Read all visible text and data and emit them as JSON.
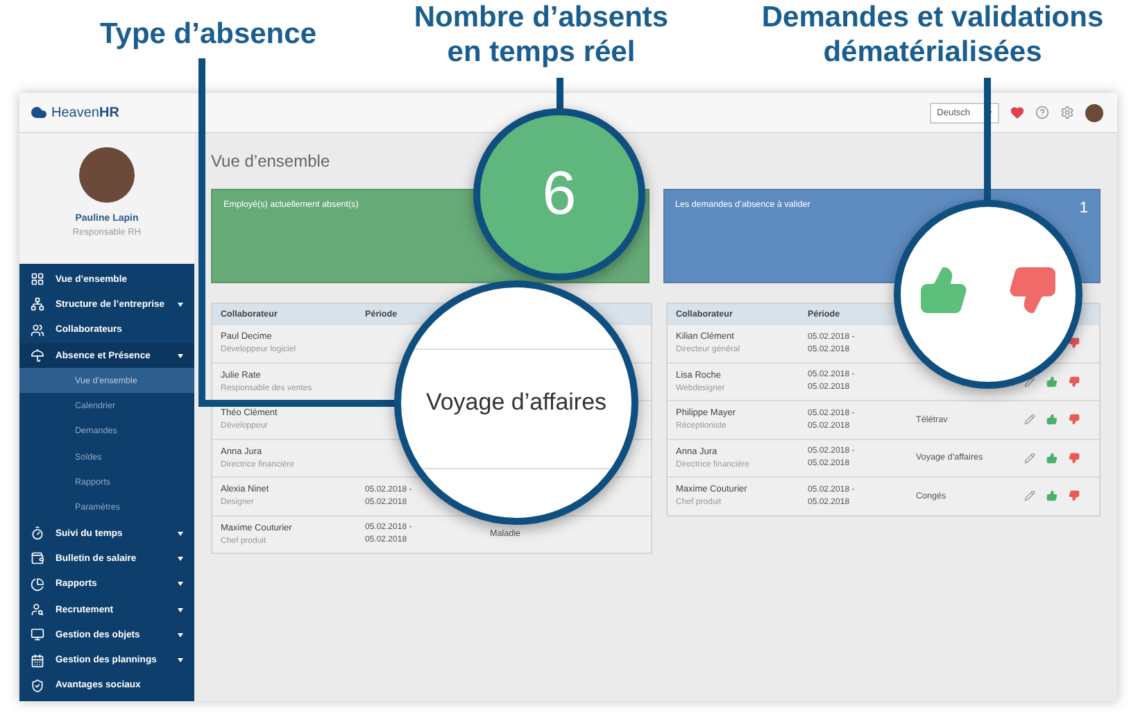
{
  "callouts": [
    {
      "lines": [
        "Type d’absence"
      ]
    },
    {
      "lines": [
        "Nombre d’absents",
        "en temps réel"
      ]
    },
    {
      "lines": [
        "Demandes et validations",
        "dématérialisées"
      ]
    }
  ],
  "magnifiers": {
    "absent_count": "6",
    "absence_type": "Voyage d’affaires"
  },
  "topbar": {
    "logo": "Heaven**HR**",
    "language": "Deutsch"
  },
  "profile": {
    "name": "Pauline Lapin",
    "role": "Responsable RH"
  },
  "nav": [
    {
      "label": "Vue d’ensemble",
      "selected": false,
      "expandable": false
    },
    {
      "label": "Structure de l’entreprise",
      "selected": false,
      "expandable": true
    },
    {
      "label": "Collaborateurs",
      "selected": false,
      "expandable": false
    },
    {
      "label": "Absence et Présence",
      "selected": true,
      "expandable": true,
      "expanded": true,
      "children": [
        {
          "label": "Vue d’ensemble",
          "selected": true
        },
        {
          "label": "Calendrier",
          "selected": false
        },
        {
          "label": "Demandes",
          "selected": false
        },
        {
          "label": "Soldes",
          "selected": false
        },
        {
          "label": "Rapports",
          "selected": false
        },
        {
          "label": "Paramètres",
          "selected": false
        }
      ]
    },
    {
      "label": "Suivi du temps",
      "selected": false,
      "expandable": true
    },
    {
      "label": "Bulletin de salaire",
      "selected": false,
      "expandable": true
    },
    {
      "label": "Rapports",
      "selected": false,
      "expandable": true
    },
    {
      "label": "Recrutement",
      "selected": false,
      "expandable": true
    },
    {
      "label": "Gestion des objets",
      "selected": false,
      "expandable": true
    },
    {
      "label": "Gestion des plannings",
      "selected": false,
      "expandable": true
    },
    {
      "label": "Avantages sociaux",
      "selected": false,
      "expandable": false
    }
  ],
  "page_title": "Vue d’ensemble",
  "cards": [
    {
      "label": "Employé(s) actuellement absent(s)",
      "color": "#66aa78"
    },
    {
      "label": "Les demandes d’absence à valider",
      "count": "1",
      "color": "#5e8cc0"
    }
  ],
  "absent_table": {
    "columns": [
      "Collaborateur",
      "Période"
    ],
    "rows": [
      {
        "name": "Paul Decime",
        "role": "Développeur logiciel"
      },
      {
        "name": "Julie Rate",
        "role": "Responsable des ventes"
      },
      {
        "name": "Théo Clément",
        "role": "Développeur"
      },
      {
        "name": "Anna Jura",
        "role": "Directrice financière"
      },
      {
        "name": "Alexia Ninet",
        "role": "Designer",
        "period": [
          "05.02.2018 -",
          "05.02.2018"
        ]
      },
      {
        "name": "Maxime Couturier",
        "role": "Chef produit",
        "period": [
          "05.02.2018 -",
          "05.02.2018"
        ],
        "type": "Maladie"
      }
    ]
  },
  "requests_table": {
    "columns": [
      "Collaborateur",
      "Période"
    ],
    "rows": [
      {
        "name": "Kilian Clément",
        "role": "Directeur général",
        "period": [
          "05.02.2018 -",
          "05.02.2018"
        ]
      },
      {
        "name": "Lisa Roche",
        "role": "Webdesigner",
        "period": [
          "05.02.2018 -",
          "05.02.2018"
        ]
      },
      {
        "name": "Philippe Mayer",
        "role": "Réceptioniste",
        "period": [
          "05.02.2018 -",
          "05.02.2018"
        ],
        "type": "Télétrav"
      },
      {
        "name": "Anna Jura",
        "role": "Directrice financière",
        "period": [
          "05.02.2018 -",
          "05.02.2018"
        ],
        "type": "Voyage d’affaires"
      },
      {
        "name": "Maxime Couturier",
        "role": "Chef produit",
        "period": [
          "05.02.2018 -",
          "05.02.2018"
        ],
        "type": "Congés"
      }
    ]
  }
}
